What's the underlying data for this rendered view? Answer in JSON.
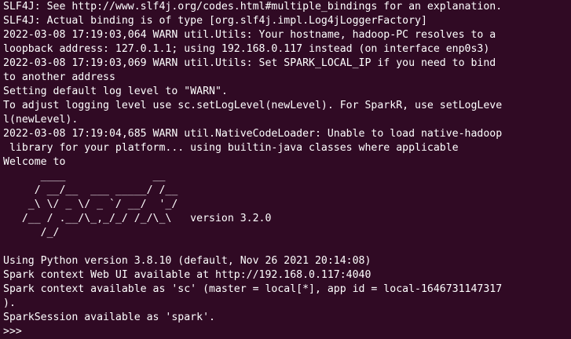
{
  "terminal": {
    "lines": [
      "SLF4J: See http://www.slf4j.org/codes.html#multiple_bindings for an explanation.",
      "SLF4J: Actual binding is of type [org.slf4j.impl.Log4jLoggerFactory]",
      "2022-03-08 17:19:03,064 WARN util.Utils: Your hostname, hadoop-PC resolves to a",
      "loopback address: 127.0.1.1; using 192.168.0.117 instead (on interface enp0s3)",
      "2022-03-08 17:19:03,069 WARN util.Utils: Set SPARK_LOCAL_IP if you need to bind",
      "to another address",
      "Setting default log level to \"WARN\".",
      "To adjust logging level use sc.setLogLevel(newLevel). For SparkR, use setLogLeve",
      "l(newLevel).",
      "2022-03-08 17:19:04,685 WARN util.NativeCodeLoader: Unable to load native-hadoop",
      " library for your platform... using builtin-java classes where applicable",
      "Welcome to",
      "      ____              __",
      "     / __/__  ___ _____/ /__",
      "    _\\ \\/ _ \\/ _ `/ __/  '_/",
      "   /__ / .__/\\_,_/_/ /_/\\_\\   version 3.2.0",
      "      /_/",
      "",
      "Using Python version 3.8.10 (default, Nov 26 2021 20:14:08)",
      "Spark context Web UI available at http://192.168.0.117:4040",
      "Spark context available as 'sc' (master = local[*], app id = local-1646731147317",
      ").",
      "SparkSession available as 'spark'.",
      ">>> "
    ]
  }
}
